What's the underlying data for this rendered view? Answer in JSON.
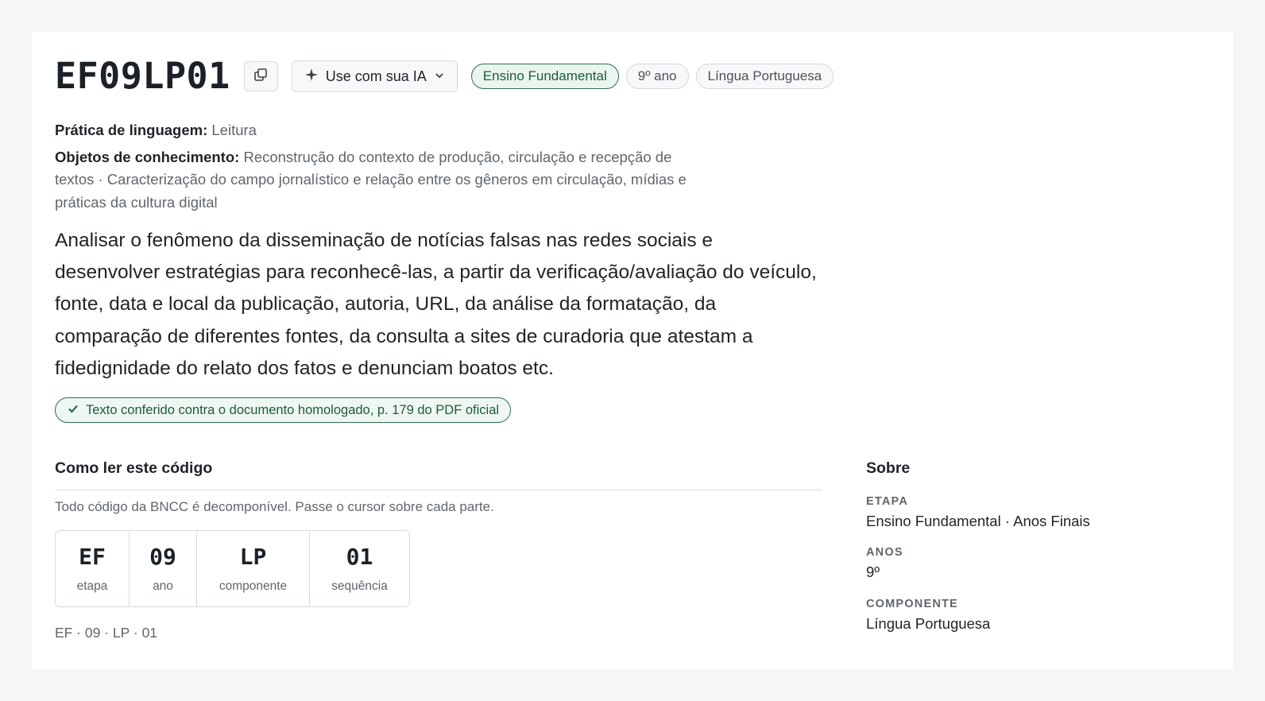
{
  "header": {
    "code": "EF09LP01",
    "ia_button_label": "Use com sua IA",
    "tags": [
      "Ensino Fundamental",
      "9º ano",
      "Língua Portuguesa"
    ]
  },
  "meta": {
    "pratica_label": "Prática de linguagem:",
    "pratica_value": "Leitura",
    "objetos_label": "Objetos de conhecimento:",
    "objetos_value": "Reconstrução do contexto de produção, circulação e recepção de textos · Caracterização do campo jornalístico e relação entre os gêneros em circulação, mídias e práticas da cultura digital"
  },
  "description": "Analisar o fenômeno da disseminação de notícias falsas nas redes sociais e desenvolver estratégias para reconhecê-las, a partir da verificação/avaliação do veículo, fonte, data e local da publicação, autoria, URL, da análise da formatação, da comparação de diferentes fontes, da consulta a sites de curadoria que atestam a fidedignidade do relato dos fatos e denunciam boatos etc.",
  "verified_text": "Texto conferido contra o documento homologado, p. 179 do PDF oficial",
  "how_to_read": {
    "title": "Como ler este código",
    "hint": "Todo código da BNCC é decomponível. Passe o cursor sobre cada parte.",
    "segments": [
      {
        "code": "EF",
        "label": "etapa"
      },
      {
        "code": "09",
        "label": "ano"
      },
      {
        "code": "LP",
        "label": "componente"
      },
      {
        "code": "01",
        "label": "sequência"
      }
    ],
    "breakdown": "EF · 09 · LP · 01"
  },
  "sobre": {
    "title": "Sobre",
    "items": [
      {
        "key": "ETAPA",
        "value": "Ensino Fundamental · Anos Finais"
      },
      {
        "key": "ANOS",
        "value": "9º"
      },
      {
        "key": "COMPONENTE",
        "value": "Língua Portuguesa"
      }
    ]
  }
}
